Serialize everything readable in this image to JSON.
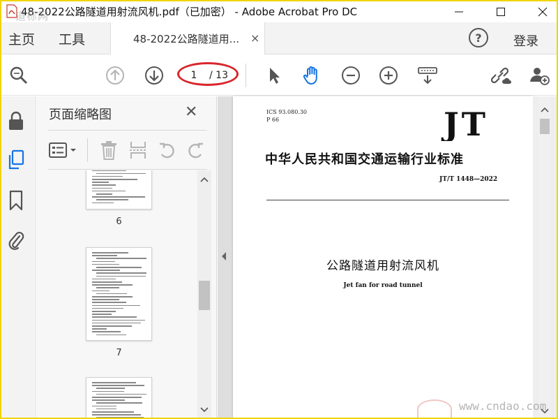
{
  "window": {
    "title": "48-2022公路隧道用射流风机.pdf（已加密） - Adobe Acrobat Pro DC",
    "watermark_top": "道标网"
  },
  "menubar": {
    "home_label": "主页",
    "tools_label": "工具",
    "tab_label": "48-2022公路隧道用...",
    "tab_close": "×",
    "help_label": "?",
    "login_label": "登录"
  },
  "toolbar": {
    "current_page": "1",
    "total_pages": "/ 13"
  },
  "thumb_panel": {
    "title": "页面缩略图",
    "close": "✕",
    "pages": [
      {
        "label": "6"
      },
      {
        "label": "7"
      },
      {
        "label": ""
      }
    ]
  },
  "document": {
    "ics": "ICS 93.080.30",
    "pcode": "P 66",
    "logo_text": "JT",
    "standard_title": "中华人民共和国交通运输行业标准",
    "standard_number": "JT/T 1448—2022",
    "title_cn": "公路隧道用射流风机",
    "title_en": "Jet fan for road tunnel"
  },
  "watermark_bottom": "www.cndao.com",
  "colors": {
    "frame": "#f0d400",
    "accent_blue": "#1473e6",
    "annotation_red": "#d9262c"
  }
}
